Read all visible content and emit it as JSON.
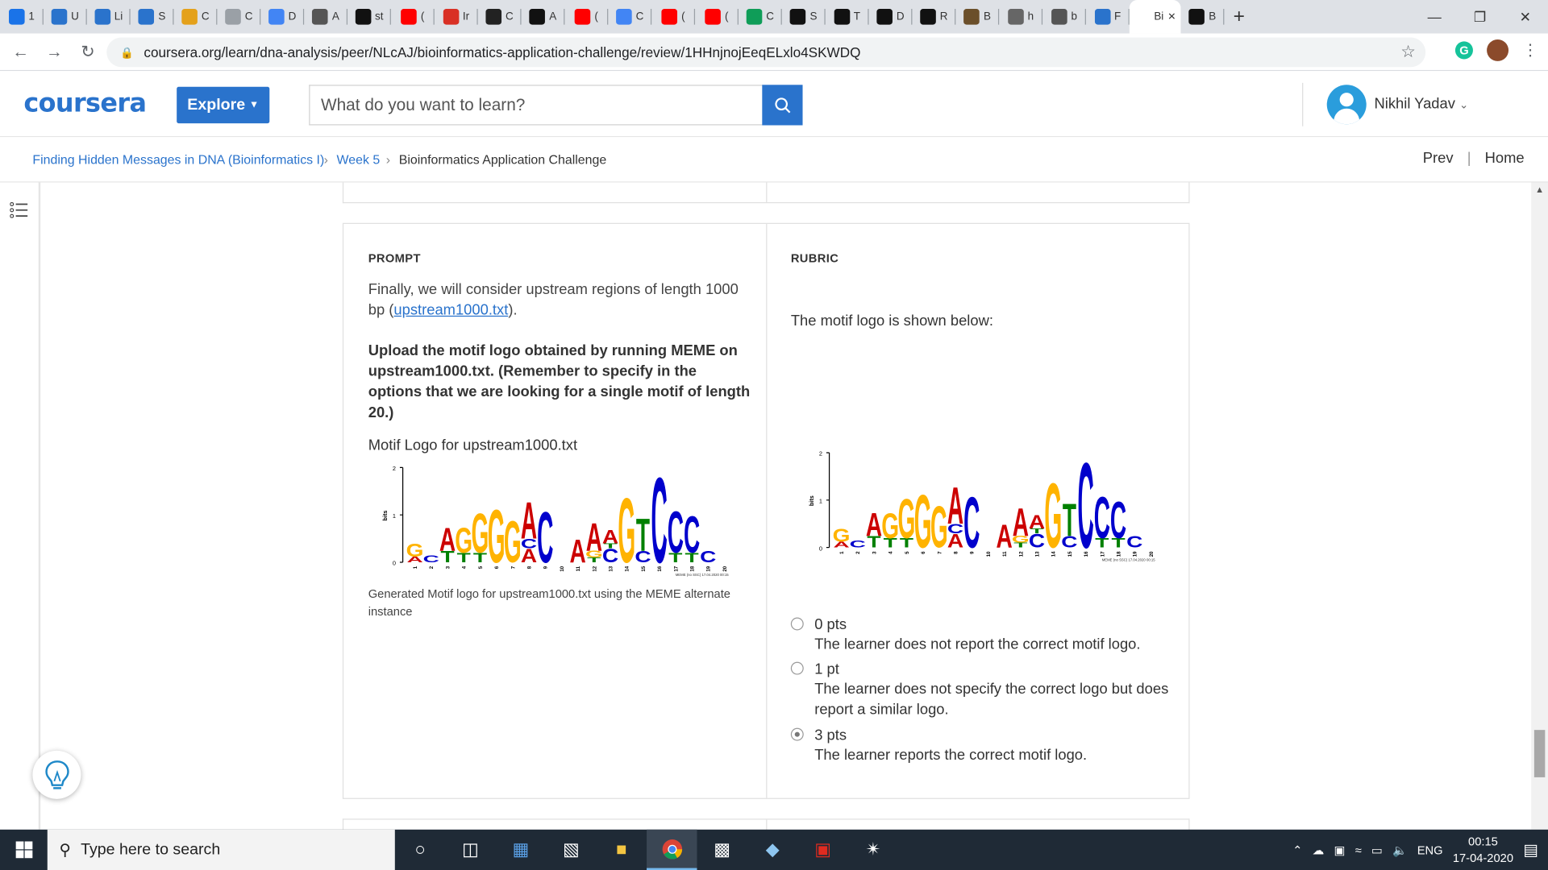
{
  "browser": {
    "tabs": [
      {
        "label": "1",
        "icon": "mountain-icon",
        "color": "#1a73e8"
      },
      {
        "label": "U",
        "icon": "infinity-icon",
        "color": "#2a73cc"
      },
      {
        "label": "Li",
        "icon": "infinity-icon",
        "color": "#2a73cc"
      },
      {
        "label": "S",
        "icon": "infinity-icon",
        "color": "#2a73cc"
      },
      {
        "label": "C",
        "icon": "folder-icon",
        "color": "#e4a11b"
      },
      {
        "label": "C",
        "icon": "page-icon",
        "color": "#9aa0a6"
      },
      {
        "label": "D",
        "icon": "docs-icon",
        "color": "#4285f4"
      },
      {
        "label": "A",
        "icon": "robot-icon",
        "color": "#555555"
      },
      {
        "label": "st",
        "icon": "github-icon",
        "color": "#111111"
      },
      {
        "label": "(",
        "icon": "youtube-icon",
        "color": "#ff0000"
      },
      {
        "label": "Ir",
        "icon": "gmail-icon",
        "color": "#d93025"
      },
      {
        "label": "C",
        "icon": "m-icon",
        "color": "#222222"
      },
      {
        "label": "A",
        "icon": "a-icon",
        "color": "#111111"
      },
      {
        "label": "(",
        "icon": "youtube-icon",
        "color": "#ff0000"
      },
      {
        "label": "C",
        "icon": "google-icon",
        "color": "#4285f4"
      },
      {
        "label": "(",
        "icon": "youtube-icon",
        "color": "#ff0000"
      },
      {
        "label": "(",
        "icon": "youtube-icon",
        "color": "#ff0000"
      },
      {
        "label": "C",
        "icon": "drive-icon",
        "color": "#0f9d58"
      },
      {
        "label": "S",
        "icon": "notion-icon",
        "color": "#111111"
      },
      {
        "label": "T",
        "icon": "notion-icon",
        "color": "#111111"
      },
      {
        "label": "D",
        "icon": "notion-icon",
        "color": "#111111"
      },
      {
        "label": "R",
        "icon": "notion-icon",
        "color": "#111111"
      },
      {
        "label": "B",
        "icon": "figure-icon",
        "color": "#6b4f2a"
      },
      {
        "label": "h",
        "icon": "ide-icon",
        "color": "#666666"
      },
      {
        "label": "b",
        "icon": "globe-icon",
        "color": "#555555"
      },
      {
        "label": "F",
        "icon": "infinity-icon",
        "color": "#2a73cc"
      }
    ],
    "active_tab": {
      "label": "Bi"
    },
    "last_tab": {
      "label": "B",
      "icon": "github-icon"
    },
    "url": "coursera.org/learn/dna-analysis/peer/NLcAJ/bioinformatics-application-challenge/review/1HHnjnojEeqELxlo4SKWDQ"
  },
  "header": {
    "logo": "coursera",
    "explore_label": "Explore",
    "search_placeholder": "What do you want to learn?",
    "user_name": "Nikhil Yadav"
  },
  "breadcrumb": {
    "items": [
      "Finding Hidden Messages in DNA (Bioinformatics I)",
      "Week 5",
      "Bioinformatics Application Challenge"
    ],
    "prev": "Prev",
    "home": "Home"
  },
  "prompt": {
    "heading": "PROMPT",
    "text_before": "Finally, we will consider upstream regions of length 1000 bp (",
    "link": "upstream1000.txt",
    "text_after": ").",
    "bold": "Upload the motif logo obtained by running MEME on upstream1000.txt. (Remember to specify in the options that we are looking for a single motif of length 20.)",
    "logo_title": "Motif Logo for upstream1000.txt",
    "caption": "Generated Motif logo for upstream1000.txt using the MEME alternate instance"
  },
  "rubric": {
    "heading": "RUBRIC",
    "text": "The motif logo is shown below:",
    "options": [
      {
        "points": "0 pts",
        "desc": "The learner does not report the correct motif logo.",
        "selected": false
      },
      {
        "points": "1 pt",
        "desc": "The learner does not specify the correct logo but does report a similar logo.",
        "selected": false
      },
      {
        "points": "3 pts",
        "desc": "The learner reports the correct motif logo.",
        "selected": true
      }
    ]
  },
  "motif_logo": {
    "ylabel": "bits",
    "yticks": [
      "0",
      "1",
      "2"
    ],
    "positions": [
      "1",
      "2",
      "3",
      "4",
      "5",
      "6",
      "7",
      "8",
      "9",
      "10",
      "11",
      "12",
      "13",
      "14",
      "15",
      "16",
      "17",
      "18",
      "19",
      "20"
    ],
    "colors": {
      "A": "#cc0000",
      "C": "#0000cc",
      "G": "#ffb300",
      "T": "#008000"
    },
    "columns": [
      [
        [
          "A",
          0.12
        ],
        [
          "G",
          0.28
        ]
      ],
      [
        [
          "C",
          0.15
        ]
      ],
      [
        [
          "T",
          0.25
        ],
        [
          "A",
          0.5
        ]
      ],
      [
        [
          "T",
          0.2
        ],
        [
          "G",
          0.55
        ]
      ],
      [
        [
          "T",
          0.2
        ],
        [
          "G",
          0.85
        ]
      ],
      [
        [
          "G",
          1.15
        ]
      ],
      [
        [
          "G",
          0.9
        ]
      ],
      [
        [
          "A",
          0.3
        ],
        [
          "C",
          0.2
        ],
        [
          "A",
          0.8
        ]
      ],
      [
        [
          "C",
          1.1
        ]
      ],
      [],
      [
        [
          "A",
          0.5
        ]
      ],
      [
        [
          "T",
          0.1
        ],
        [
          "G",
          0.15
        ],
        [
          "A",
          0.6
        ]
      ],
      [
        [
          "C",
          0.3
        ],
        [
          "T",
          0.1
        ],
        [
          "A",
          0.3
        ]
      ],
      [
        [
          "G",
          1.4
        ]
      ],
      [
        [
          "C",
          0.25
        ],
        [
          "T",
          0.7
        ]
      ],
      [
        [
          "C",
          1.85
        ]
      ],
      [
        [
          "T",
          0.2
        ],
        [
          "C",
          0.9
        ]
      ],
      [
        [
          "T",
          0.2
        ],
        [
          "C",
          0.8
        ]
      ],
      [
        [
          "C",
          0.25
        ]
      ],
      []
    ],
    "footer": "MEME (no SSC) 17.04.2020 00:15"
  },
  "taskbar": {
    "search_placeholder": "Type here to search",
    "language": "ENG",
    "time": "00:15",
    "date": "17-04-2020"
  }
}
